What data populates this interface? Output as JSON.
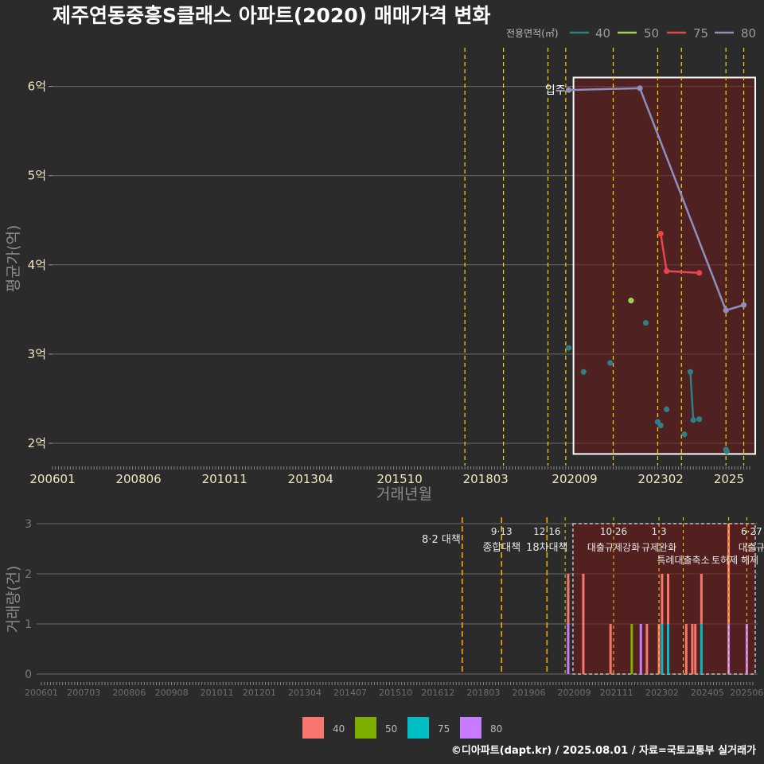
{
  "title": "제주연동중흥S클래스 아파트(2020) 매매가격 변화",
  "credit": "©디아파트(dapt.kr) / 2025.08.01 / 자료=국토교통부 실거래가",
  "colors": {
    "background": "#2b2b2b",
    "line_40": "#2f7f86",
    "line_50": "#9cd45a",
    "line_75": "#e6474a",
    "line_80": "#8f8fbf",
    "bar_40": "#f8766d",
    "bar_50": "#7cae00",
    "bar_75": "#00bfc4",
    "bar_80": "#c77cff",
    "policy_line": "#ffd700",
    "policy_line_bottom": "#ffa500"
  },
  "chart_data": [
    {
      "type": "line",
      "title": "제주연동중흥S클래스 아파트(2020) 매매가격 변화",
      "xlabel": "거래년월",
      "ylabel": "평균가(억)",
      "x_ticks": [
        "200601",
        "200806",
        "201011",
        "201304",
        "201510",
        "201803",
        "202009",
        "202302",
        "2025"
      ],
      "y_ticks": [
        "2억",
        "3억",
        "4억",
        "5억",
        "6억"
      ],
      "ylim": [
        1.75,
        6.3
      ],
      "legend_title": "전용면적(㎡)",
      "legend_position": "top-right",
      "series": [
        {
          "name": "40",
          "points": [
            {
              "x": "2020-07",
              "y": 3.07
            },
            {
              "x": "2020-12",
              "y": 2.8
            },
            {
              "x": "2021-09",
              "y": 2.9
            },
            {
              "x": "2022-09",
              "y": 3.35
            },
            {
              "x": "2023-01",
              "y": 2.24
            },
            {
              "x": "2023-02",
              "y": 2.2
            },
            {
              "x": "2023-04",
              "y": 2.38
            },
            {
              "x": "2023-10",
              "y": 2.1
            },
            {
              "x": "2023-12",
              "y": 2.8
            },
            {
              "x": "2024-01",
              "y": 2.26
            },
            {
              "x": "2024-03",
              "y": 2.27
            },
            {
              "x": "2024-12",
              "y": 1.93
            },
            {
              "x": "2024-12",
              "y": 1.91
            }
          ]
        },
        {
          "name": "50",
          "points": [
            {
              "x": "2022-04",
              "y": 3.6
            }
          ]
        },
        {
          "name": "75",
          "points": [
            {
              "x": "2023-02",
              "y": 4.35
            },
            {
              "x": "2023-04",
              "y": 3.93
            },
            {
              "x": "2024-03",
              "y": 3.91
            }
          ]
        },
        {
          "name": "80",
          "points": [
            {
              "x": "2020-07",
              "y": 5.96
            },
            {
              "x": "2022-07",
              "y": 5.98
            },
            {
              "x": "2024-12",
              "y": 3.49
            },
            {
              "x": "2025-06",
              "y": 3.55
            }
          ]
        }
      ],
      "annotations": [
        {
          "text": "입주",
          "x": "2020-07",
          "y": 5.96
        }
      ],
      "highlight_range": {
        "from": "2020-07",
        "to": "2025-08"
      },
      "policy_lines": [
        "2017-08",
        "2018-09",
        "2019-12",
        "2020-06",
        "2021-10",
        "2023-01",
        "2023-09",
        "2024-12",
        "2025-06"
      ]
    },
    {
      "type": "bar",
      "xlabel": "",
      "ylabel": "거래량(건)",
      "x_ticks": [
        "200601",
        "200703",
        "200806",
        "200908",
        "201011",
        "201201",
        "201304",
        "201407",
        "201510",
        "201612",
        "201803",
        "201906",
        "202009",
        "202111",
        "202302",
        "202405",
        "202506"
      ],
      "y_ticks": [
        "0",
        "1",
        "2",
        "3"
      ],
      "ylim": [
        0,
        3
      ],
      "legend_position": "bottom",
      "legend": [
        "40",
        "50",
        "75",
        "80"
      ],
      "bars": [
        {
          "x": "2020-07",
          "stack": [
            {
              "s": "40",
              "v": 1
            },
            {
              "s": "80",
              "v": 1
            }
          ]
        },
        {
          "x": "2020-12",
          "stack": [
            {
              "s": "40",
              "v": 2
            }
          ]
        },
        {
          "x": "2021-09",
          "stack": [
            {
              "s": "40",
              "v": 1
            }
          ]
        },
        {
          "x": "2022-04",
          "stack": [
            {
              "s": "50",
              "v": 1
            }
          ]
        },
        {
          "x": "2022-07",
          "stack": [
            {
              "s": "80",
              "v": 1
            }
          ]
        },
        {
          "x": "2022-09",
          "stack": [
            {
              "s": "40",
              "v": 1
            }
          ]
        },
        {
          "x": "2023-01",
          "stack": [
            {
              "s": "40",
              "v": 1
            }
          ]
        },
        {
          "x": "2023-02",
          "stack": [
            {
              "s": "40",
              "v": 1
            },
            {
              "s": "75",
              "v": 1
            }
          ]
        },
        {
          "x": "2023-04",
          "stack": [
            {
              "s": "40",
              "v": 1
            },
            {
              "s": "75",
              "v": 1
            }
          ]
        },
        {
          "x": "2023-10",
          "stack": [
            {
              "s": "40",
              "v": 1
            }
          ]
        },
        {
          "x": "2023-12",
          "stack": [
            {
              "s": "40",
              "v": 1
            }
          ]
        },
        {
          "x": "2024-01",
          "stack": [
            {
              "s": "40",
              "v": 1
            }
          ]
        },
        {
          "x": "2024-03",
          "stack": [
            {
              "s": "40",
              "v": 1
            },
            {
              "s": "75",
              "v": 1
            }
          ]
        },
        {
          "x": "2024-12",
          "stack": [
            {
              "s": "40",
              "v": 2
            },
            {
              "s": "80",
              "v": 1
            }
          ]
        },
        {
          "x": "2025-06",
          "stack": [
            {
              "s": "80",
              "v": 1
            }
          ]
        }
      ],
      "policies": [
        {
          "x": "2017-08",
          "date": "",
          "label": "8·2 대책"
        },
        {
          "x": "2018-09",
          "date": "9·13",
          "label": "종합대책"
        },
        {
          "x": "2019-12",
          "date": "12·16",
          "label": "18차대책"
        },
        {
          "x": "2020-06",
          "date": "",
          "label": ""
        },
        {
          "x": "2021-10",
          "date": "10·26",
          "label": "대출규제강화"
        },
        {
          "x": "2023-01",
          "date": "1·3",
          "label": "규제완화"
        },
        {
          "x": "2023-09",
          "date": "9·7",
          "label": "특례대출축소"
        },
        {
          "x": "2024-12",
          "date": "",
          "label": "토허제 해제"
        },
        {
          "x": "2025-06",
          "date": "6·27",
          "label": "대출규"
        }
      ]
    }
  ]
}
